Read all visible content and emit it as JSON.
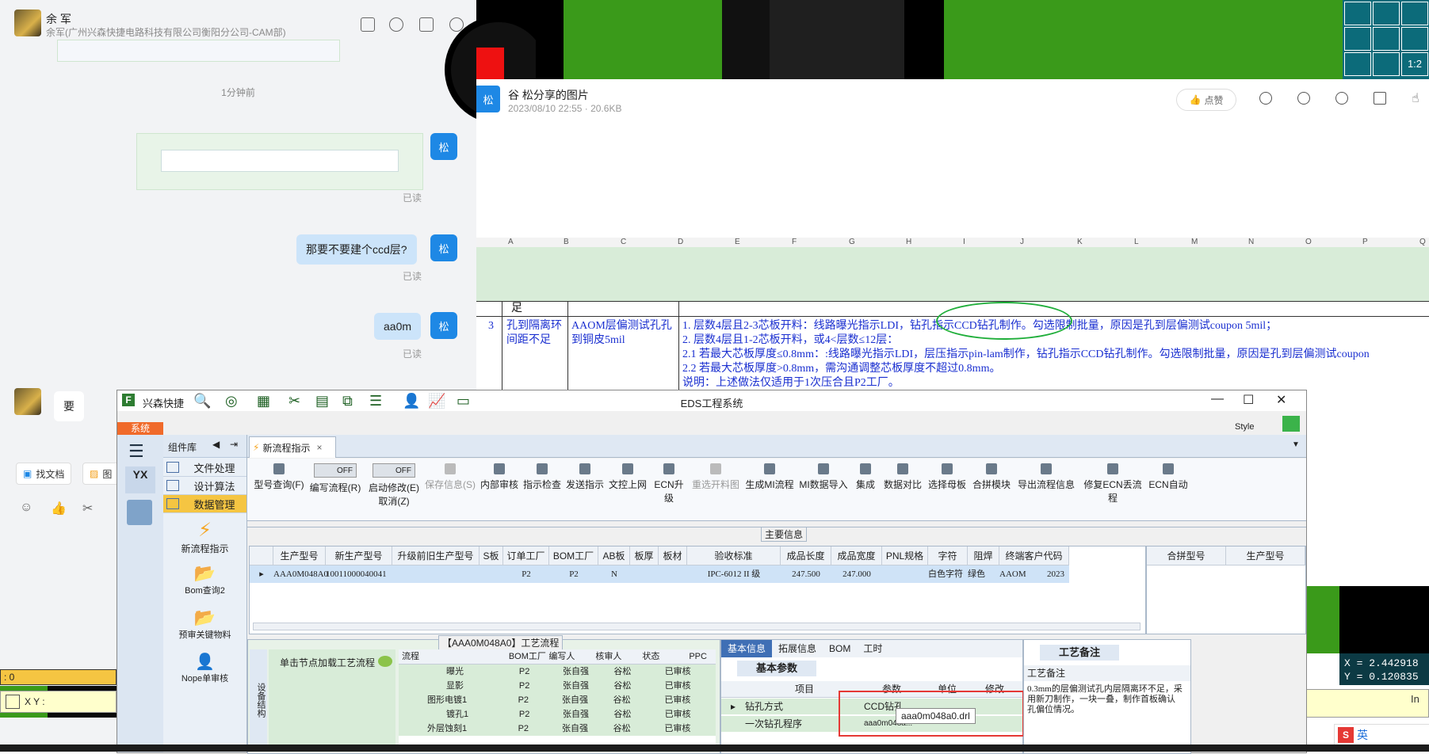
{
  "chat": {
    "contact_name": "余 军",
    "contact_sub": "余军(广州兴森快捷电路科技有限公司衡阳分公司-CAM部)",
    "time_mark": "1分钟前",
    "sender_badge": "松",
    "read_label": "已读",
    "messages": [
      "那要不要建个ccd层?",
      "aa0m"
    ],
    "other_msg": "要",
    "tools": [
      "找文档",
      "图"
    ]
  },
  "viewer": {
    "sender_badge": "松",
    "title": "谷 松分享的图片",
    "meta": "2023/08/10 22:55 · 20.6KB",
    "like_label": "点赞",
    "coord_x": "X = 2.442918",
    "coord_y": "Y = 0.120835",
    "zoom_label": "1:2"
  },
  "sheet": {
    "col_headers": [
      "A",
      "B",
      "C",
      "D",
      "E",
      "F",
      "G",
      "H",
      "I",
      "J",
      "K",
      "L",
      "M",
      "N",
      "O",
      "P",
      "Q"
    ],
    "top_cell": "足",
    "row_no": "3",
    "col_b": "孔到隔离环间距不足",
    "col_c": "AAOM层偏测试孔孔到铜皮5mil",
    "lines": [
      "1. 层数4层且2-3芯板开料：线路曝光指示LDI，钻孔指示CCD钻孔制作。勾选限制批量，原因是孔到层偏测试coupon  5mil；",
      "2. 层数4层且1-2芯板开料，或4<层数≤12层：",
      "2.1 若最大芯板厚度≤0.8mm：:线路曝光指示LDI，层压指示pin-lam制作，钻孔指示CCD钻孔制作。勾选限制批量，原因是孔到层偏测试coupon",
      "2.2 若最大芯板厚度>0.8mm，需沟通调整芯板厚度不超过0.8mm。",
      "说明：上述做法仅适用于1次压合且P2工厂。"
    ]
  },
  "eds": {
    "app_name": "兴森快捷",
    "window_title": "EDS工程系统",
    "system_tab": "系统",
    "style_label": "Style",
    "group_title": "组件库",
    "modules": [
      "文件处理",
      "设计算法",
      "数据管理"
    ],
    "side_items": [
      "新流程指示",
      "Bom查询2",
      "预审关键物料",
      "Nope单审核"
    ],
    "side_logo": "YX",
    "doc_tab": "新流程指示",
    "toolbar": [
      "型号查询(F)",
      "编写流程(R)",
      "启动修改(E)",
      "保存信息(S)",
      "内部审核",
      "指示检查",
      "发送指示",
      "文控上网",
      "ECN升级",
      "重选开料图",
      "生成MI流程",
      "MI数据导入",
      "集成",
      "数据对比",
      "选择母板",
      "合拼模块",
      "导出流程信息",
      "修复ECN丢流程",
      "ECN自动"
    ],
    "toggle_off": "OFF",
    "cancel_label": "取消(Z)",
    "section_main": "主要信息",
    "grid_headers": [
      "生产型号",
      "新生产型号",
      "升级前旧生产型号",
      "S板",
      "订单工厂",
      "BOM工厂",
      "AB板",
      "板厚",
      "板材",
      "验收标准",
      "成品长度",
      "成品宽度",
      "PNL规格",
      "字符",
      "阻焊",
      "终端客户代码"
    ],
    "grid_row": [
      "AAA0M048A0",
      "10011000040041",
      "",
      "",
      "P2",
      "P2",
      "N",
      "",
      "",
      "IPC-6012 II 级",
      "247.500",
      "247.000",
      "",
      "白色字符",
      "绿色",
      "AAOM",
      "2023"
    ],
    "right_headers": [
      "合拼型号",
      "生产型号"
    ],
    "flow_title": "【AAA0M048A0】工艺流程",
    "flow_side_label": "单击节点加载工艺流程",
    "flow_vertical": "设备结构",
    "flow_headers": [
      "流程",
      "BOM工厂",
      "编写人",
      "核审人",
      "状态",
      "PPC"
    ],
    "flow_rows": [
      [
        "曝光",
        "P2",
        "张自强",
        "谷松",
        "已审核"
      ],
      [
        "显影",
        "P2",
        "张自强",
        "谷松",
        "已审核"
      ],
      [
        "图形电镀1",
        "P2",
        "张自强",
        "谷松",
        "已审核"
      ],
      [
        "镀孔1",
        "P2",
        "张自强",
        "谷松",
        "已审核"
      ],
      [
        "外层蚀刻1",
        "P2",
        "张自强",
        "谷松",
        "已审核"
      ]
    ],
    "info_tabs": [
      "基本信息",
      "拓展信息",
      "BOM",
      "工时"
    ],
    "basic_params": "基本参数",
    "param_headers": [
      "项目",
      "参数",
      "单位",
      "修改"
    ],
    "param_rows": [
      [
        "钻孔方式",
        "CCD钻孔"
      ],
      [
        "一次钻孔程序",
        "aaa0m048a..."
      ]
    ],
    "tooltip": "aaa0m048a0.drl",
    "remark_tab": "工艺备注",
    "remark_head": "工艺备注",
    "remark_text": "0.3mm的层偏测试孔内层隔离环不足，采用新刀制作，一块一叠，制作首板确认孔偏位情况。",
    "status_zero": ": 0",
    "xy_label": "X Y :",
    "ime_label": "英"
  },
  "colors": {
    "accent_blue": "#1e88e5",
    "bubble_blue": "#cce4fa",
    "grid_green": "#d8ecd8",
    "pcb_green": "#3a9a1a",
    "highlight_red": "#e53935",
    "selected_row": "#cfe3f7"
  }
}
